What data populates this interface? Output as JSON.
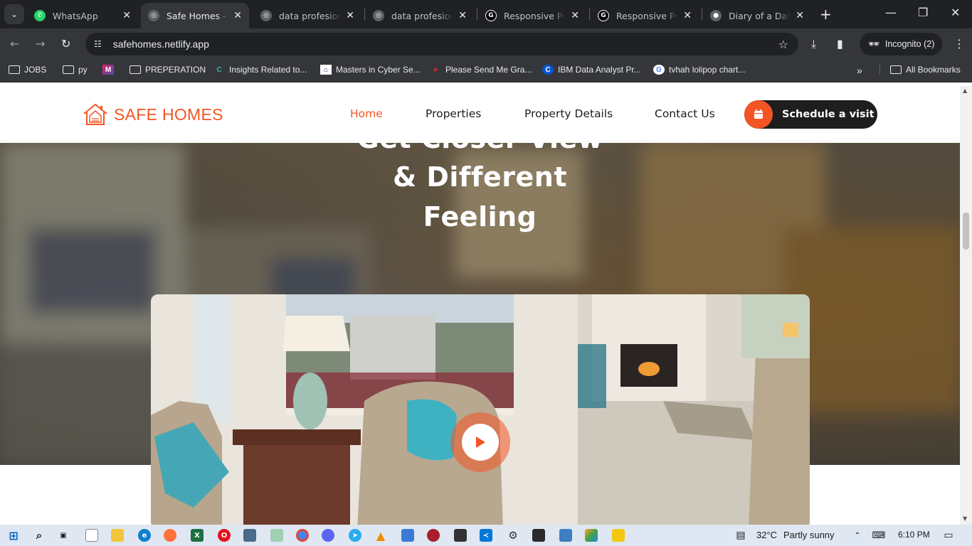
{
  "browser": {
    "tabs": [
      {
        "title": "WhatsApp",
        "icon": "whatsapp-icon",
        "color": "#25d366",
        "active": false
      },
      {
        "title": "Safe Homes - Re",
        "icon": "globe-icon",
        "color": "#5f6368",
        "active": true
      },
      {
        "title": "data profesional",
        "icon": "globe-icon",
        "color": "#5f6368",
        "active": false
      },
      {
        "title": "data profesional",
        "icon": "globe-icon",
        "color": "#5f6368",
        "active": false
      },
      {
        "title": "Responsive Portf",
        "icon": "github-icon",
        "color": "#ffffff",
        "active": false
      },
      {
        "title": "Responsive Portf",
        "icon": "github-icon",
        "color": "#ffffff",
        "active": false
      },
      {
        "title": "Diary of a Data A",
        "icon": "medium-icon",
        "color": "#bdc1c6",
        "active": false
      }
    ],
    "url": "safehomes.netlify.app",
    "incognito_label": "Incognito (2)",
    "bookmarks": [
      {
        "label": "JOBS",
        "icon": "folder-icon"
      },
      {
        "label": "py",
        "icon": "folder-icon"
      },
      {
        "label": "",
        "icon": "app-icon"
      },
      {
        "label": "PREPERATION",
        "icon": "folder-icon"
      },
      {
        "label": "Insights Related to...",
        "icon": "coursera-icon"
      },
      {
        "label": "Masters in Cyber Se...",
        "icon": "university-icon"
      },
      {
        "label": "Please Send Me Gra...",
        "icon": "leaf-icon"
      },
      {
        "label": "IBM Data Analyst Pr...",
        "icon": "coursera-icon"
      },
      {
        "label": "tvhah lolipop chart...",
        "icon": "google-icon"
      }
    ],
    "all_bookmarks_label": "All Bookmarks"
  },
  "site": {
    "brand": "SAFE HOMES",
    "brand_color": "#f35525",
    "nav": [
      {
        "label": "Home",
        "active": true
      },
      {
        "label": "Properties",
        "active": false
      },
      {
        "label": "Property Details",
        "active": false
      },
      {
        "label": "Contact Us",
        "active": false
      }
    ],
    "cta_label": "Schedule a visit",
    "hero": {
      "line0": "Get Closer View",
      "line1": "& Different",
      "line2": "Feeling"
    }
  },
  "taskbar": {
    "weather": "32°C",
    "weather_desc": "Partly sunny",
    "time": "6:10 PM"
  }
}
